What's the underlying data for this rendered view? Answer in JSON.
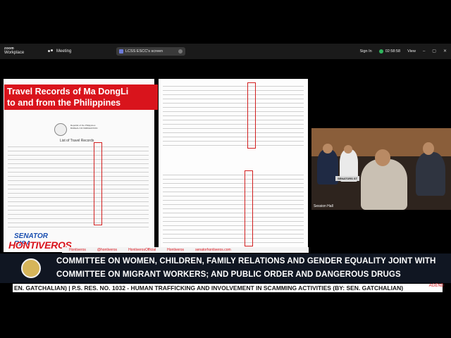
{
  "zoom": {
    "logo_line1": "zoom",
    "logo_line2": "Workplace",
    "meeting_label": "Meeting",
    "share_label": "LCSS ESCC's screen",
    "sign_in": "Sign In",
    "timer": "02:58:58",
    "view": "View"
  },
  "document": {
    "title": "List of Travel Records",
    "agency_line1": "Republic of the Philippines",
    "agency_line2": "BUREAU OF IMMIGRATION"
  },
  "headline": {
    "line1": "Travel Records of Ma DongLi",
    "line2": "to and from the Philippines"
  },
  "video": {
    "nameplate": "SENATORS ST",
    "session_label": "Session Hall"
  },
  "senator_logo": {
    "line1": "SENATOR RISA",
    "line2": "HONTIVEROS"
  },
  "social": {
    "items": [
      "Hontiveros",
      "@hontiveros",
      "HontiverosOfficial",
      "Hontiveros",
      "senatorhontiveros.com"
    ]
  },
  "lower_third": {
    "title_line1": "COMMITTEE ON WOMEN, CHILDREN, FAMILY RELATIONS AND GENDER EQUALITY JOINT WITH",
    "title_line2": "COMMITTEE ON MIGRANT WORKERS; AND PUBLIC ORDER AND DANGEROUS DRUGS"
  },
  "ticker": {
    "text": "EN. GATCHALIAN) | P.S. RES. NO. 1032 - HUMAN TRAFFICKING AND INVOLVEMENT IN SCAMMING ACTIVITIES (BY: SEN. GATCHALIAN)",
    "end": "AGEND"
  },
  "colors": {
    "accent_red": "#d9141c",
    "zoom_bar": "#1a1a1a",
    "lower_third_bg": "#101622"
  }
}
